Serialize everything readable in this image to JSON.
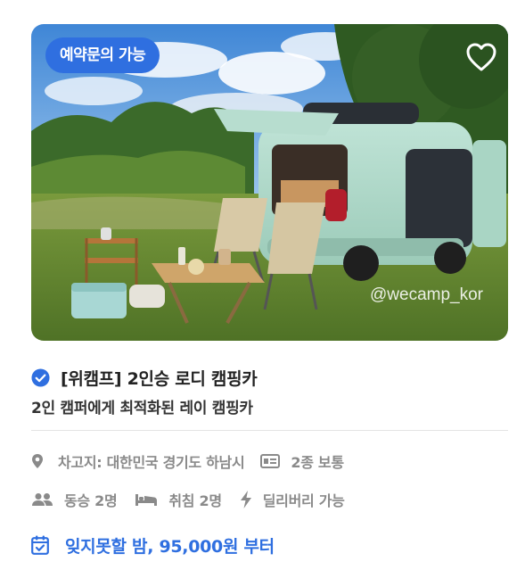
{
  "listing": {
    "badge": "예약문의 가능",
    "watermark": "@wecamp_kor",
    "title": "[위캠프] 2인승 로디 캠핑카",
    "subtitle": "2인 캠퍼에게 최적화된 레이 캠핑카",
    "location": "차고지: 대한민국 경기도 하남시",
    "license": "2종 보통",
    "passengers": "동승 2명",
    "sleeps": "취침 2명",
    "delivery": "딜리버리 가능",
    "price": "잊지못할 밤, 95,000원 부터"
  },
  "icons": {
    "favorite": "heart-outline-icon",
    "verified": "check-circle-icon",
    "location": "map-pin-icon",
    "license": "id-card-icon",
    "passengers": "people-icon",
    "sleeps": "bed-icon",
    "delivery": "lightning-icon",
    "price": "calendar-check-icon"
  },
  "colors": {
    "accent": "#2f6fe0",
    "muted": "#8a8a8a",
    "title": "#222222"
  }
}
